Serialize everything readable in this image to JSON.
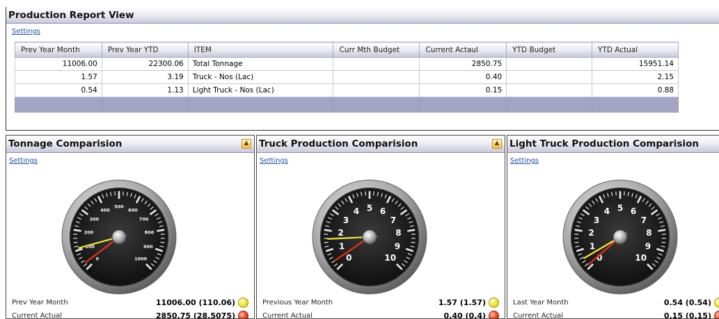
{
  "report": {
    "title": "Production Report View",
    "settings_label": "Settings",
    "columns": [
      "Prev Year Month",
      "Prev Year YTD",
      "ITEM",
      "Curr Mth Budget",
      "Current Actaul",
      "YTD Budget",
      "YTD Actual"
    ],
    "rows": [
      [
        "11006.00",
        "22300.06",
        "Total Tonnage",
        "",
        "2850.75",
        "",
        "15951.14"
      ],
      [
        "1.57",
        "3.19",
        "Truck - Nos (Lac)",
        "",
        "0.40",
        "",
        "2.15"
      ],
      [
        "0.54",
        "1.13",
        "Light Truck - Nos (Lac)",
        "",
        "0.15",
        "",
        "0.88"
      ]
    ]
  },
  "panels": [
    {
      "title": "Tonnage Comparision",
      "settings_label": "Settings",
      "collapse_icon": "chevron-up-icon",
      "gauge": {
        "min": 0,
        "max": 1000,
        "ticks": [
          "0",
          "100",
          "200",
          "300",
          "400",
          "500",
          "600",
          "700",
          "800",
          "900",
          "1000"
        ],
        "yellow_value": 110.06,
        "red_value": 28.5075,
        "label_size": "small"
      },
      "metrics": [
        {
          "label": "Prev Year Month",
          "value": "11006.00 (110.06)",
          "status": "yellow"
        },
        {
          "label": "Current Actual",
          "value": "2850.75 (28.5075)",
          "status": "red"
        }
      ]
    },
    {
      "title": "Truck Production Comparision",
      "settings_label": "Settings",
      "collapse_icon": "chevron-up-icon",
      "gauge": {
        "min": 0,
        "max": 10,
        "ticks": [
          "0",
          "1",
          "2",
          "3",
          "4",
          "5",
          "6",
          "7",
          "8",
          "9",
          "10"
        ],
        "yellow_value": 1.57,
        "red_value": 0.4,
        "label_size": "large"
      },
      "metrics": [
        {
          "label": "Previous Year Month",
          "value": "1.57 (1.57)",
          "status": "yellow"
        },
        {
          "label": "Current Actual",
          "value": "0.40 (0.4)",
          "status": "red"
        }
      ]
    },
    {
      "title": "Light Truck Production Comparision",
      "settings_label": "Settings",
      "collapse_icon": "chevron-up-icon",
      "gauge": {
        "min": 0,
        "max": 10,
        "ticks": [
          "0",
          "1",
          "2",
          "3",
          "4",
          "5",
          "6",
          "7",
          "8",
          "9",
          "10"
        ],
        "yellow_value": 0.54,
        "red_value": 0.15,
        "label_size": "large"
      },
      "metrics": [
        {
          "label": "Last Year Month",
          "value": "0.54 (0.54)",
          "status": "yellow"
        },
        {
          "label": "Current Actual",
          "value": "0.15 (0.15)",
          "status": "red"
        }
      ]
    }
  ],
  "colors": {
    "header_accent": "#c9c9da",
    "grid_footer": "#a4a4c4",
    "link": "#1f4ea8",
    "needle_yellow": "#f4e63a",
    "needle_red": "#e8321c"
  }
}
